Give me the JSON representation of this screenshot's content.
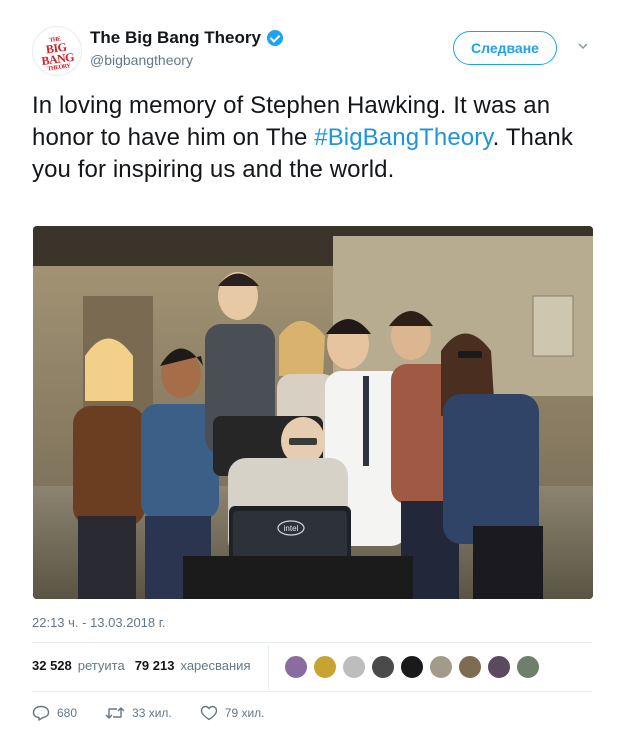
{
  "header": {
    "display_name": "The Big Bang Theory",
    "handle": "@bigbangtheory",
    "follow_label": "Следване",
    "avatar_lines": [
      "THE",
      "BIG",
      "BANG",
      "THEORY"
    ]
  },
  "tweet": {
    "text_before": "In loving memory of Stephen Hawking. It was an honor to have him on The ",
    "hashtag": "#BigBangTheory",
    "text_after": ". Thank you for inspiring us and the world.",
    "photo_badge": "intel",
    "timestamp": "22:13 ч. - 13.03.2018 г."
  },
  "stats": {
    "retweets_count": "32 528",
    "retweets_label": "ретуита",
    "likes_count": "79 213",
    "likes_label": "харесвания",
    "liker_colors": [
      "#8a6d9e",
      "#c7a432",
      "#bdbdbd",
      "#4a4a4a",
      "#1a1a1a",
      "#a39b8a",
      "#7d6b52",
      "#5a4a5e",
      "#6e7f6b"
    ]
  },
  "actions": {
    "replies": "680",
    "retweets": "33 хил.",
    "likes": "79 хил."
  },
  "colors": {
    "accent": "#1da1f2",
    "hashtag": "#1b95e0",
    "muted": "#657786"
  }
}
